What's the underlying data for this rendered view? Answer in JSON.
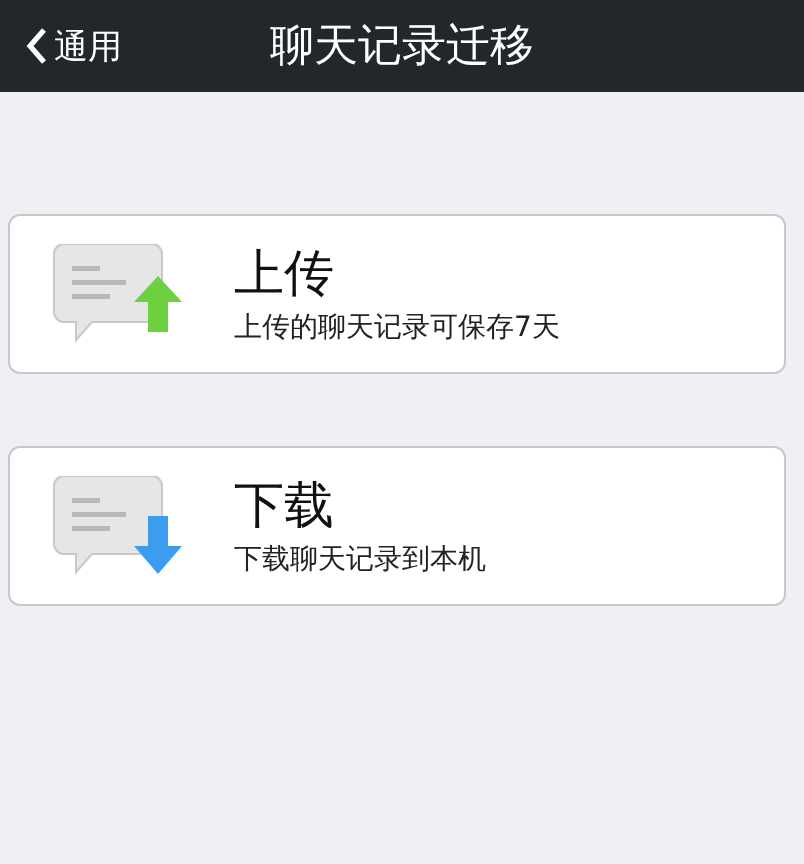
{
  "nav_bar": {
    "back_label": "通用",
    "title": "聊天记录迁移"
  },
  "options": [
    {
      "kind": "upload",
      "title": "上传",
      "description": "上传的聊天记录可保存7天"
    },
    {
      "kind": "download",
      "title": "下载",
      "description": "下载聊天记录到本机"
    }
  ]
}
